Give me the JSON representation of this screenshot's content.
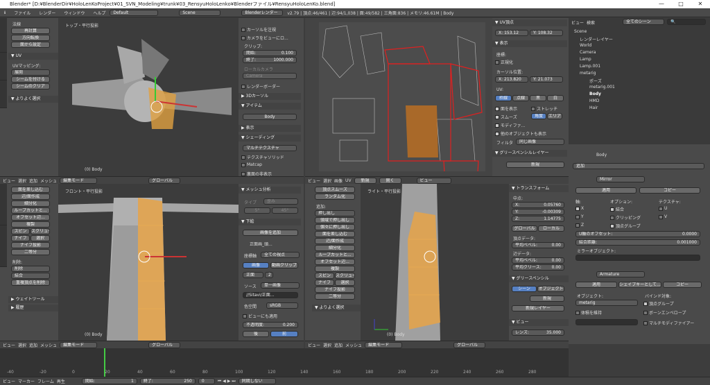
{
  "window": {
    "title": "Blender* [D:¥BlenderDir¥HoloLenKoProject¥01_SVN_Modeling¥trunk¥03_RensyuHoloLenko¥Blenderファイル¥RensyuHoloLenKo.blend]",
    "min": "—",
    "max": "□",
    "close": "✕"
  },
  "menu": {
    "file": "ファイル",
    "render": "レンダー",
    "window": "ウィンドウ",
    "help": "ヘルプ",
    "layout": "Default",
    "scene": "Scene",
    "engine": "Blenderレンダー",
    "stats": "v2.79 | 頂点:46/461 | 辺:94/1,038 | 面:49/582 | 三角面:836 | メモリ:46.61M | Body"
  },
  "left_tools": {
    "section1": "法線",
    "b1": "再計算",
    "b2": "方向転換",
    "b3": "面から設定",
    "uv_header": "▼ UV",
    "uv_mapping": "UVマッピング:",
    "unwrap": "展開",
    "mark_seam": "シームを付ける",
    "clear_seam": "シームのクリア",
    "history": "▼ よりよく選択"
  },
  "topview": {
    "label": "トップ・平行投影",
    "obj": "(0) Body"
  },
  "frontview": {
    "label": "フロント・平行投影",
    "obj": "(0) Body"
  },
  "rightview": {
    "label": "ライト・平行投影",
    "obj": "(0) Body"
  },
  "mid_props": {
    "cursor_apply": "カーソルを注視",
    "camera_view": "カメラをビューにロ...",
    "clip": "クリップ:",
    "clip_start_label": "開始:",
    "clip_start": "0.100",
    "clip_end_label": "終了:",
    "clip_end": "1000.000",
    "local_camera": "ローカルカメラ",
    "camera": "Camera",
    "render_border": "レンダーボーダー",
    "cursor3d": "▶ 3Dカーソル",
    "item": "▼ アイテム",
    "item_name": "Body",
    "display": "▶ 表示",
    "shading": "▼ シェーディング",
    "shading_mode": "マルチテクスチャ",
    "texture_solid": "テクスチャソリッド",
    "matcap": "Matcap",
    "backface": "裏面の非表示"
  },
  "edit_tools": {
    "b1": "面を差し込む",
    "b2": "辺/面作成",
    "b3": "細分化",
    "b4": "ループカットと...",
    "b5": "オフセット辺...",
    "b6": "複製",
    "b7": "スピン",
    "b8": "スクリュー",
    "b9": "ナイフ",
    "b10": "選択",
    "b11": "ナイフ投影",
    "b12": "二等分",
    "delete_label": "削除:",
    "delete": "削除",
    "merge": "結合",
    "remove_doubles": "重複頂点を削除",
    "weight": "▶ ウェイトツール",
    "history": "▶ 履歴"
  },
  "mesh_analysis": {
    "header": "▼ メッシュ分析",
    "type_label": "タイプ",
    "type": "歪み",
    "v1": "5°",
    "v2": "45°",
    "bg_header": "▼ 下絵",
    "add_image": "画像を追加",
    "image_name": "正面画_頭...",
    "axis_label": "座標軸",
    "axis": "全ての視点",
    "image": "画像",
    "movie": "動画クリップ",
    "front": "正面",
    "two": "2",
    "source_label": "ソース",
    "source": "単一画像",
    "path": "//Sitavi/正面...",
    "colorspace_label": "色空間",
    "colorspace": "sRGB",
    "view_align": "ビューにも適用",
    "opacity_label": "不透明度:",
    "opacity": "0.200",
    "back": "後",
    "front2": "前"
  },
  "vert_tools": {
    "b1": "頂点スムーズ",
    "b2": "ランダム化",
    "add_label": "追加:",
    "b3": "押し出し",
    "b4": "領域で押し出し",
    "b5": "個々に押し出し",
    "b6": "面を差し込む",
    "b7": "辺/面作成",
    "b8": "細分化",
    "b9": "ループカットと...",
    "b10": "オフセット辺...",
    "b11": "複製",
    "b12": "スピン",
    "b13": "スクリュー",
    "b14": "ナイフ",
    "b15": "選択",
    "b16": "ナイフ投影",
    "b17": "二等分",
    "history": "▼ よりよく選択"
  },
  "uv_props": {
    "uv_vert": "▼ UV頂点",
    "x_label": "X:",
    "x": "153.12",
    "y_label": "Y:",
    "y": "108.32",
    "display": "▼ 表示",
    "coords": "座標:",
    "normalize": "正規化",
    "cursor_pos": "カーソル位置:",
    "cx": "X: 213.820",
    "cy": "Y: 21.073",
    "uv": "UV:",
    "outline": "枠線",
    "dash": "点線",
    "black": "黒",
    "white": "白",
    "draw_faces": "面を表示",
    "stretch": "ストレッチ",
    "smooth": "スムーズ",
    "angle": "角度",
    "area": "エリア",
    "modified": "モディファ...",
    "other_obj": "他のオブジェクトも表示",
    "filter_label": "フィルタ",
    "filter": "同じ画像",
    "grease": "▼ グリースペンシルレイヤー",
    "new": "新規"
  },
  "transform": {
    "header": "▼ トランスフォーム",
    "median": "中点:",
    "x_label": "X:",
    "x": "0.05760",
    "y_label": "Y:",
    "y": "-0.00309",
    "z_label": "Z:",
    "z": "1.14775",
    "global": "グローバル",
    "local": "ローカル",
    "vdata": "頂点データ:",
    "bevel": "平均ベベル:",
    "bevel_v": "0.00",
    "edata": "辺データ:",
    "ebevel_v": "0.00",
    "crease": "平均クリース:",
    "crease_v": "0.00",
    "gp": "▼ グリースペンシル",
    "scene": "シーン",
    "object": "オブジェクト",
    "new": "新規",
    "new_layer": "新規レイヤー",
    "view": "▼ ビュー",
    "lens_label": "レンズ:",
    "lens": "35.000"
  },
  "outliner": {
    "view": "ビュー",
    "search": "検索",
    "all_scenes": "全てのシーン",
    "items": [
      "Scene",
      "レンダーレイヤー",
      "World",
      "Camera",
      "Lamp",
      "Lamp.001",
      "metarig",
      "ポーズ",
      "metarig.001",
      "Body",
      "HMD",
      "Hair"
    ]
  },
  "properties": {
    "object": "Body",
    "add_modifier": "追加",
    "mirror": "Mirror",
    "apply": "適用",
    "copy": "コピー",
    "axis": "軸:",
    "options": "オプション:",
    "texture": "テクスチャ:",
    "x": "X",
    "y": "Y",
    "z": "Z",
    "merge": "結合",
    "clipping": "クリッピング",
    "vgroup": "頂点グループ",
    "u": "U",
    "v": "V",
    "u_offset": "U軸のオフセット:",
    "u_offset_v": "0.0000",
    "merge_dist": "結合距離:",
    "merge_dist_v": "0.001000",
    "mirror_obj": "ミラーオブジェクト:",
    "armature": "Armature",
    "shape_key": "シェイプキーとして...",
    "object_label": "オブジェクト:",
    "object_v": "metarig",
    "bind": "バインド対象:",
    "vgroup2": "頂点グループ",
    "bone_env": "ボーンエンベロープ",
    "keep_vol": "体積を維持",
    "multi_mod": "マルチモディファイアー"
  },
  "view_menus": {
    "view": "ビュー",
    "select": "選択",
    "add": "追加",
    "mesh": "メッシュ",
    "mode": "編集モード",
    "global": "グローバル",
    "image": "画像",
    "uv": "UV",
    "new": "新規",
    "open": "開く"
  },
  "timeline": {
    "view": "ビュー",
    "marker": "マーカー",
    "frame": "フレーム",
    "play": "再生",
    "start_label": "開始:",
    "start": "1",
    "end_label": "終了:",
    "end": "250",
    "current": "0",
    "sync": "同期しない",
    "ticks": [
      "-40",
      "-20",
      "0",
      "20",
      "40",
      "60",
      "80",
      "100",
      "120",
      "140",
      "160",
      "180",
      "200",
      "220",
      "240",
      "260",
      "280"
    ]
  }
}
